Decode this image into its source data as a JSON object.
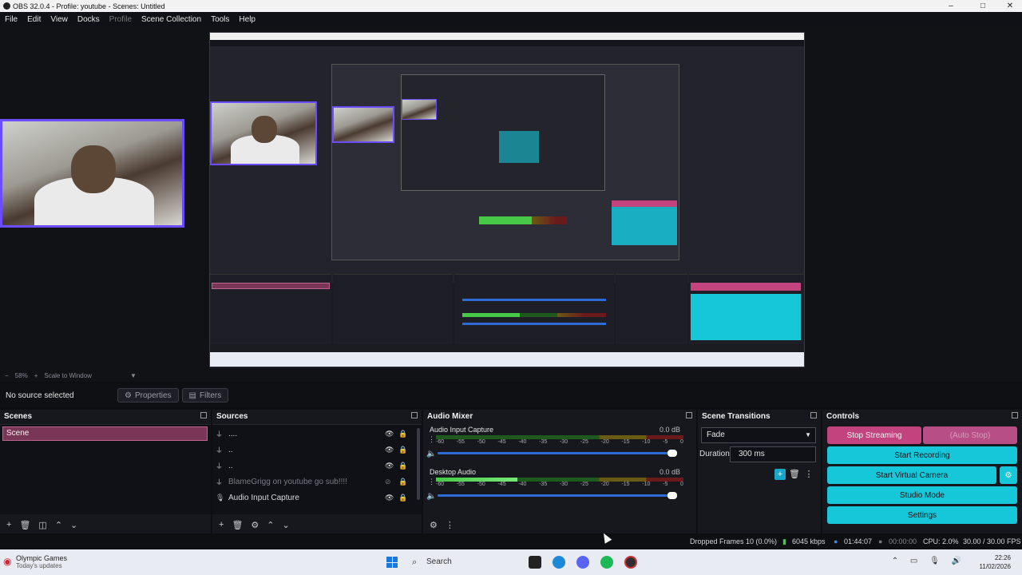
{
  "window": {
    "title": "OBS 32.0.4 - Profile: youtube - Scenes: Untitled",
    "controls": [
      "–",
      "□",
      "✕"
    ]
  },
  "menu": [
    "File",
    "Edit",
    "View",
    "Docks",
    "Profile",
    "Scene Collection",
    "Tools",
    "Help"
  ],
  "preview": {
    "zoom": "58%",
    "scale_label": "Scale to Window"
  },
  "source_toolbar": {
    "no_source": "No source selected",
    "properties": "Properties",
    "filters": "Filters"
  },
  "scenes": {
    "title": "Scenes",
    "items": [
      "Scene"
    ]
  },
  "sources": {
    "title": "Sources",
    "items": [
      {
        "label": "....",
        "icon": "mixer-icon",
        "visible": true,
        "dim": false
      },
      {
        "label": "..",
        "icon": "mixer-icon",
        "visible": true,
        "dim": false
      },
      {
        "label": "..",
        "icon": "mixer-icon",
        "visible": true,
        "dim": false
      },
      {
        "label": "BlameGrigg on youtube go sub!!!!",
        "icon": "mixer-icon",
        "visible": false,
        "dim": true
      },
      {
        "label": "Audio Input Capture",
        "icon": "mic-icon",
        "visible": true,
        "dim": false
      }
    ]
  },
  "audio_mixer": {
    "title": "Audio Mixer",
    "channels": [
      {
        "name": "Audio Input Capture",
        "db": "0.0 dB",
        "level": 0.0
      },
      {
        "name": "Desktop Audio",
        "db": "0.0 dB",
        "level": 0.33
      }
    ],
    "scale": [
      "-60",
      "-55",
      "-50",
      "-45",
      "-40",
      "-35",
      "-30",
      "-25",
      "-20",
      "-15",
      "-10",
      "-5",
      "0"
    ]
  },
  "scene_transitions": {
    "title": "Scene Transitions",
    "transition": "Fade",
    "duration_label": "Duration",
    "duration": "300 ms"
  },
  "controls": {
    "title": "Controls",
    "stop_streaming": "Stop Streaming",
    "auto_stop": "(Auto Stop)",
    "start_recording": "Start Recording",
    "start_virtual_camera": "Start Virtual Camera",
    "studio_mode": "Studio Mode",
    "settings": "Settings"
  },
  "status": {
    "dropped_frames": "Dropped Frames 10 (0.0%)",
    "bitrate": "6045 kbps",
    "stream_time": "01:44:07",
    "record_time": "00:00:00",
    "cpu": "CPU: 2.0%",
    "fps": "30.00 / 30.00 FPS"
  },
  "taskbar": {
    "news_title": "Olympic Games",
    "news_sub": "Today's updates",
    "search": "Search",
    "time": "22:26",
    "date": "11/02/2026"
  },
  "colors": {
    "accent_teal": "#16c6d9",
    "accent_pink": "#c2437e",
    "webcam_border": "#6c4cff"
  }
}
